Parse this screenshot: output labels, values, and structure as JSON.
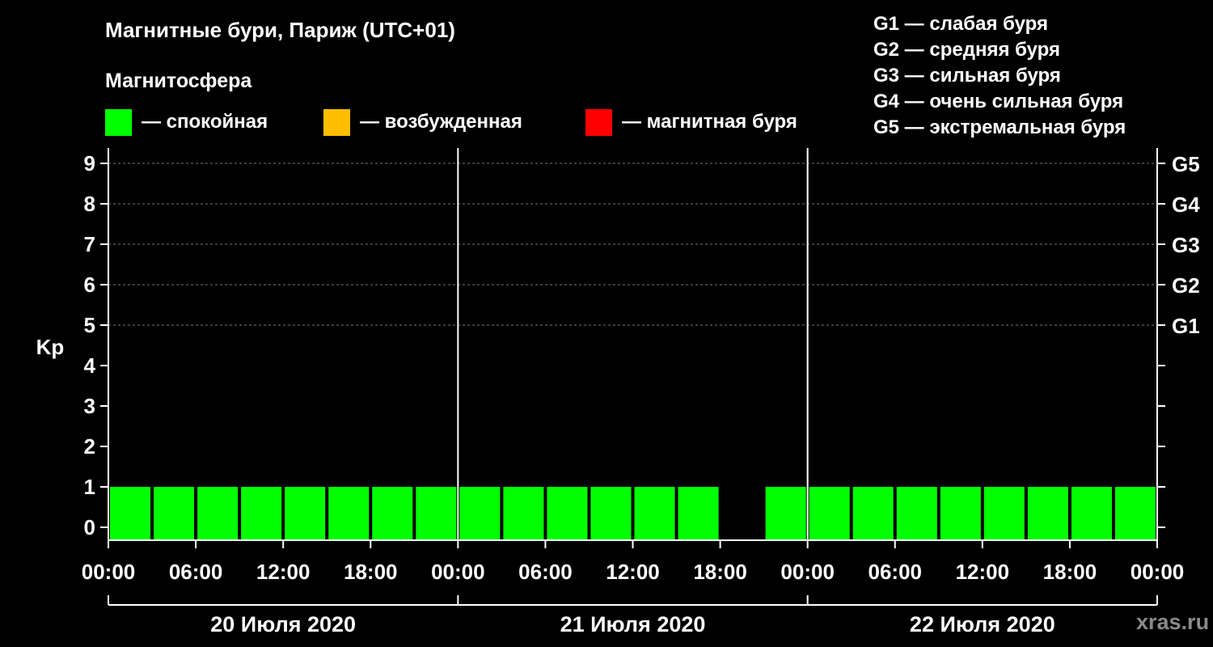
{
  "title": "Магнитные бури, Париж (UTC+01)",
  "subtitle": "Магнитосфера",
  "legend": [
    {
      "label": "— спокойная",
      "color": "#00ff00"
    },
    {
      "label": "— возбужденная",
      "color": "#ffbf00"
    },
    {
      "label": "— магнитная буря",
      "color": "#ff0000"
    }
  ],
  "storm_levels": [
    "G1 — слабая буря",
    "G2 — средняя буря",
    "G3 — сильная буря",
    "G4 — очень сильная буря",
    "G5 — экстремальная буря"
  ],
  "watermark": "xras.ru",
  "chart_data": {
    "type": "bar",
    "ylabel": "Kp",
    "ylim": [
      0,
      9
    ],
    "yticks": [
      "0",
      "1",
      "2",
      "3",
      "4",
      "5",
      "6",
      "7",
      "8",
      "9"
    ],
    "right_ticks": [
      {
        "value": 5,
        "label": "G1"
      },
      {
        "value": 6,
        "label": "G2"
      },
      {
        "value": 7,
        "label": "G3"
      },
      {
        "value": 8,
        "label": "G4"
      },
      {
        "value": 9,
        "label": "G5"
      }
    ],
    "xticks": [
      "00:00",
      "06:00",
      "12:00",
      "18:00",
      "00:00",
      "06:00",
      "12:00",
      "18:00",
      "00:00",
      "06:00",
      "12:00",
      "18:00",
      "00:00"
    ],
    "days": [
      "20 Июля 2020",
      "21 Июля 2020",
      "22 Июля 2020"
    ],
    "x_unit": "hours from 20 Июля 2020 00:00",
    "bars": [
      {
        "start": 0,
        "end": 3,
        "kp": 1,
        "status": "спокойная"
      },
      {
        "start": 3,
        "end": 6,
        "kp": 1,
        "status": "спокойная"
      },
      {
        "start": 6,
        "end": 9,
        "kp": 1,
        "status": "спокойная"
      },
      {
        "start": 9,
        "end": 12,
        "kp": 1,
        "status": "спокойная"
      },
      {
        "start": 12,
        "end": 15,
        "kp": 1,
        "status": "спокойная"
      },
      {
        "start": 15,
        "end": 18,
        "kp": 1,
        "status": "спокойная"
      },
      {
        "start": 18,
        "end": 21,
        "kp": 1,
        "status": "спокойная"
      },
      {
        "start": 21,
        "end": 24,
        "kp": 1,
        "status": "спокойная"
      },
      {
        "start": 24,
        "end": 27,
        "kp": 1,
        "status": "спокойная"
      },
      {
        "start": 27,
        "end": 30,
        "kp": 1,
        "status": "спокойная"
      },
      {
        "start": 30,
        "end": 33,
        "kp": 1,
        "status": "спокойная"
      },
      {
        "start": 33,
        "end": 36,
        "kp": 1,
        "status": "спокойная"
      },
      {
        "start": 36,
        "end": 39,
        "kp": 1,
        "status": "спокойная"
      },
      {
        "start": 39,
        "end": 42,
        "kp": 1,
        "status": "спокойная"
      },
      {
        "start": 42,
        "end": 45,
        "kp": 0,
        "status": "спокойная"
      },
      {
        "start": 45,
        "end": 48,
        "kp": 1,
        "status": "спокойная"
      },
      {
        "start": 48,
        "end": 51,
        "kp": 1,
        "status": "спокойная"
      },
      {
        "start": 51,
        "end": 54,
        "kp": 1,
        "status": "спокойная"
      },
      {
        "start": 54,
        "end": 57,
        "kp": 1,
        "status": "спокойная"
      },
      {
        "start": 57,
        "end": 60,
        "kp": 1,
        "status": "спокойная"
      },
      {
        "start": 60,
        "end": 63,
        "kp": 1,
        "status": "спокойная"
      },
      {
        "start": 63,
        "end": 66,
        "kp": 1,
        "status": "спокойная"
      },
      {
        "start": 66,
        "end": 69,
        "kp": 1,
        "status": "спокойная"
      },
      {
        "start": 69,
        "end": 72,
        "kp": 1,
        "status": "спокойная"
      }
    ]
  }
}
